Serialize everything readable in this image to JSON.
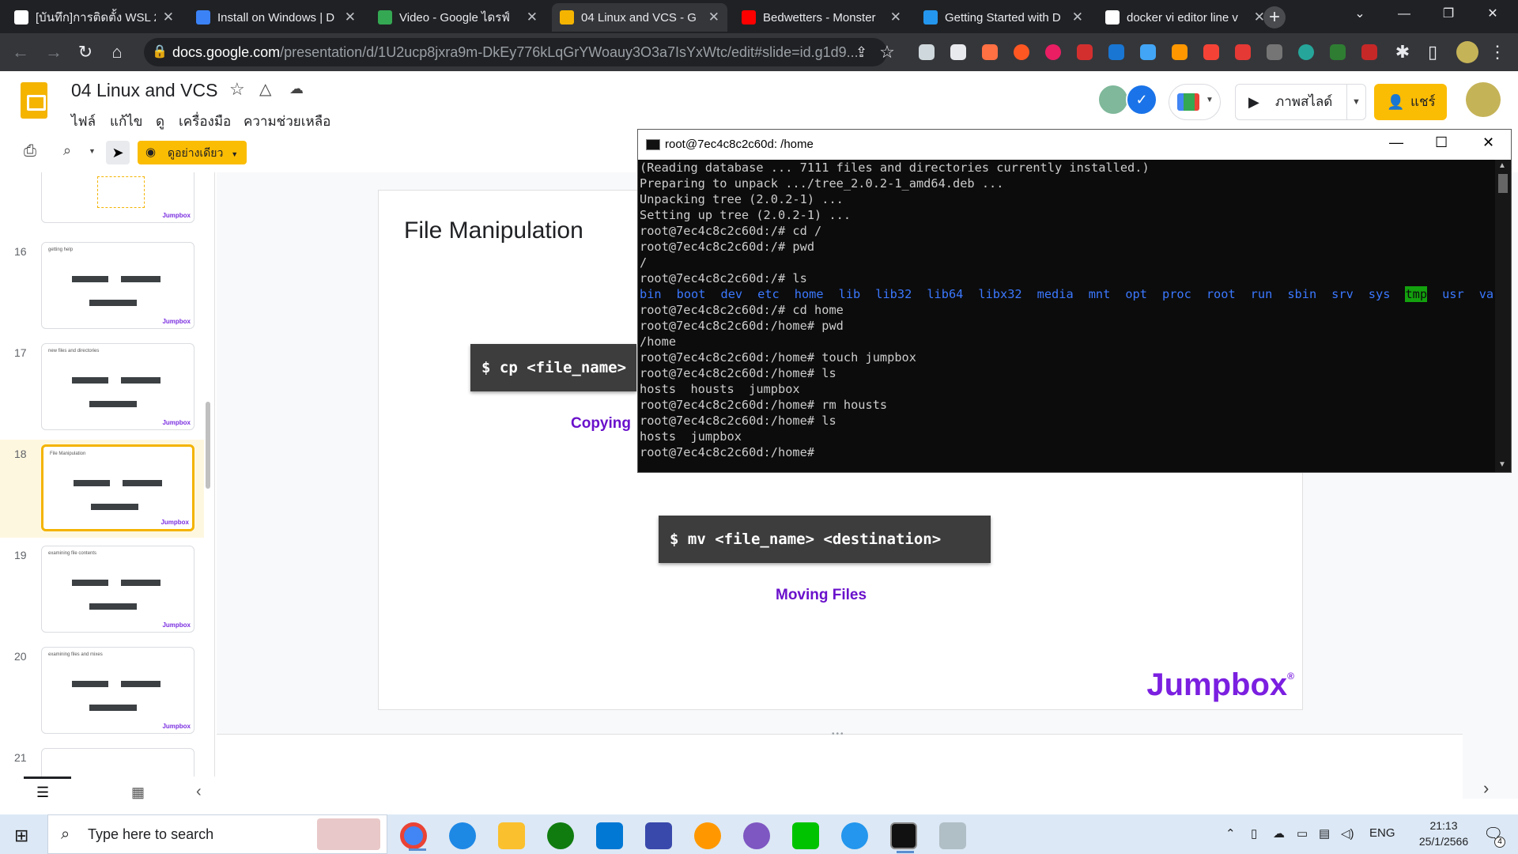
{
  "browser": {
    "tabs": [
      {
        "title": "[บันทึก]การติดตั้ง WSL 2",
        "color": "#ffffff"
      },
      {
        "title": "Install on Windows | D",
        "color": "#3b82f6"
      },
      {
        "title": "Video - Google ไดรฟ์",
        "color": "#34a853"
      },
      {
        "title": "04 Linux and VCS - G",
        "color": "#f4b400",
        "active": true
      },
      {
        "title": "Bedwetters - Monster",
        "color": "#ff0000"
      },
      {
        "title": "Getting Started with D",
        "color": "#2496ed"
      },
      {
        "title": "docker vi editor line v",
        "color": "#ffffff"
      }
    ],
    "url_host": "docs.google.com",
    "url_path": "/presentation/d/1U2ucp8jxra9m-DkEy776kLqGrYWoauy3O3a7IsYxWtc/edit#slide=id.g1d9..."
  },
  "slides_app": {
    "doc_title": "04 Linux and VCS",
    "menus": [
      "ไฟล์",
      "แก้ไข",
      "ดู",
      "เครื่องมือ",
      "ความช่วยเหลือ"
    ],
    "present_label": "ภาพสไลด์",
    "share_label": "แชร์",
    "view_mode_label": "ดูอย่างเดียว"
  },
  "filmstrip": {
    "slides": [
      {
        "num": "16",
        "title": "getting help"
      },
      {
        "num": "17",
        "title": "new files and directories"
      },
      {
        "num": "18",
        "title": "File Manipulation",
        "selected": true
      },
      {
        "num": "19",
        "title": "examining file contents"
      },
      {
        "num": "20",
        "title": "examining files and mixes"
      },
      {
        "num": "21",
        "title": ""
      }
    ],
    "thumb_brand": "Jumpbox"
  },
  "slide": {
    "title": "File Manipulation",
    "cp_cmd": "$ cp <file_name>",
    "cp_caption": "Copying",
    "mv_cmd": "$ mv <file_name> <destination>",
    "mv_caption": "Moving Files",
    "brand": "Jumpbox",
    "brand_mark": "®"
  },
  "terminal": {
    "title": "root@7ec4c8c2c60d: /home",
    "lines": [
      "(Reading database ... 7111 files and directories currently installed.)",
      "Preparing to unpack .../tree_2.0.2-1_amd64.deb ...",
      "Unpacking tree (2.0.2-1) ...",
      "Setting up tree (2.0.2-1) ...",
      "root@7ec4c8c2c60d:/# cd /",
      "root@7ec4c8c2c60d:/# pwd",
      "/",
      "root@7ec4c8c2c60d:/# ls"
    ],
    "ls_dirs": [
      "bin",
      "boot",
      "dev",
      "etc",
      "home",
      "lib",
      "lib32",
      "lib64",
      "libx32",
      "media",
      "mnt",
      "opt",
      "proc",
      "root",
      "run",
      "sbin",
      "srv",
      "sys",
      "tmp",
      "usr",
      "var"
    ],
    "lines_after": [
      "root@7ec4c8c2c60d:/# cd home",
      "root@7ec4c8c2c60d:/home# pwd",
      "/home",
      "root@7ec4c8c2c60d:/home# touch jumpbox",
      "root@7ec4c8c2c60d:/home# ls",
      "hosts  housts  jumpbox",
      "root@7ec4c8c2c60d:/home# rm housts",
      "root@7ec4c8c2c60d:/home# ls",
      "hosts  jumpbox",
      "root@7ec4c8c2c60d:/home# "
    ],
    "colors": {
      "dir": "#3b78ff",
      "tmp_bg": "#13a10e",
      "fg": "#cccccc"
    }
  },
  "taskbar": {
    "search_placeholder": "Type here to search",
    "language": "ENG",
    "time": "21:13",
    "date": "25/1/2566",
    "notification_count": "4"
  }
}
